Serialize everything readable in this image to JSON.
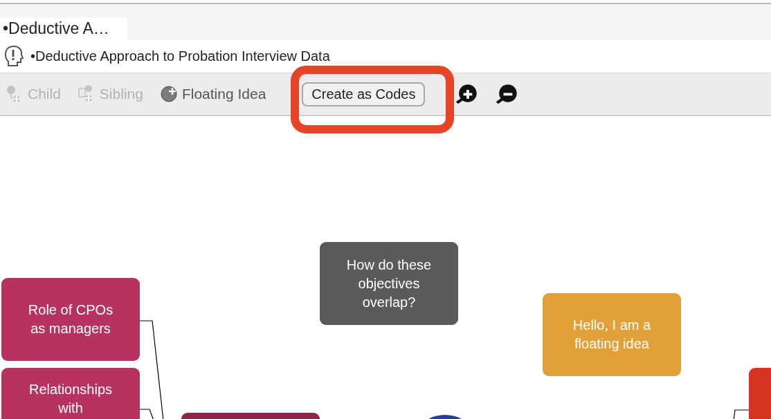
{
  "tab": "•Deductive A…",
  "map_title": "•Deductive Approach to Probation Interview Data",
  "toolbar": {
    "items": [
      {
        "kind": "child",
        "label": "Child",
        "disabled": true
      },
      {
        "kind": "sibling",
        "label": "Sibling",
        "disabled": true
      },
      {
        "kind": "floating",
        "label": "Floating Idea",
        "disabled": false
      }
    ],
    "button": "Create as Codes",
    "zoom_buttons": [
      {
        "kind": "zoom_in"
      },
      {
        "kind": "zoom_out"
      }
    ],
    "highlighted": true
  },
  "nodes": [
    {
      "text": "How do these objectives overlap?",
      "color": "#5a5a5a"
    },
    {
      "text": "Hello, I am a floating idea",
      "color": "#e2a038"
    },
    {
      "text": "Role of CPOs as managers",
      "color": "#b5335c"
    },
    {
      "text": "Relationships with",
      "color": "#b5335c"
    },
    {
      "color": "#8e2447"
    },
    {
      "color": "#d63324"
    }
  ],
  "central_node": {
    "color": "#27409a"
  }
}
